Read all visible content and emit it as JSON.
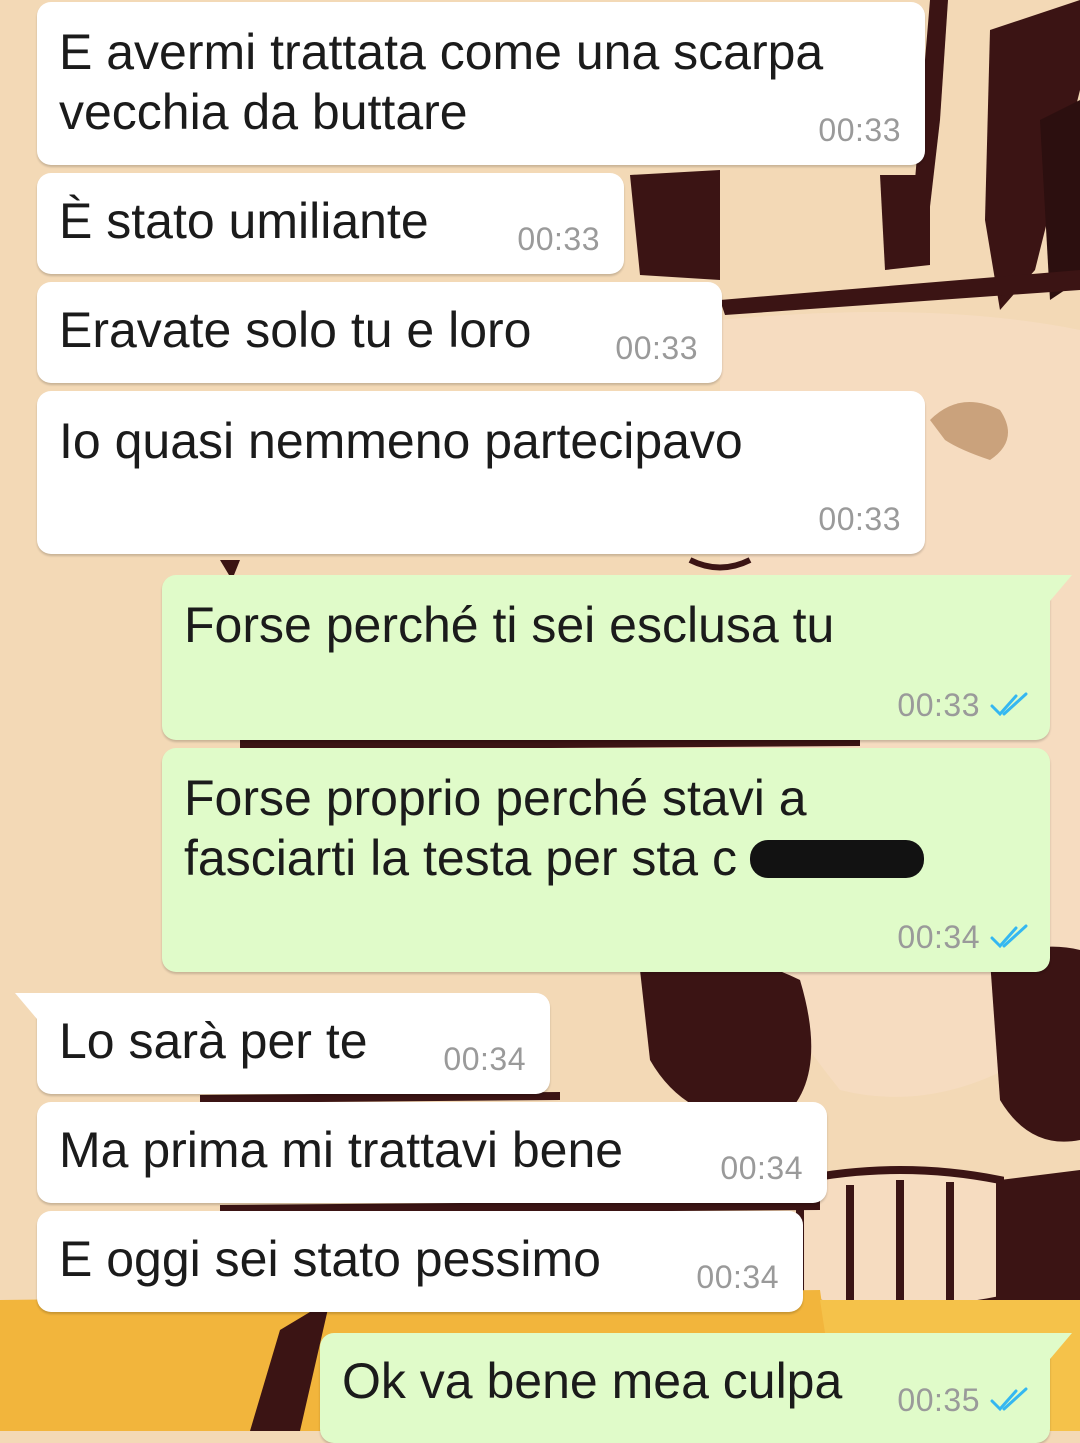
{
  "messages": [
    {
      "id": "m1",
      "direction": "incoming",
      "text": "E avermi trattata come una scarpa\nvecchia da buttare",
      "time": "00:33"
    },
    {
      "id": "m2",
      "direction": "incoming",
      "text": "È stato umiliante",
      "time": "00:33"
    },
    {
      "id": "m3",
      "direction": "incoming",
      "text": "Eravate solo tu e loro",
      "time": "00:33"
    },
    {
      "id": "m4",
      "direction": "incoming",
      "text": "Io quasi nemmeno partecipavo",
      "time": "00:33"
    },
    {
      "id": "m5",
      "direction": "outgoing",
      "text": "Forse perché ti sei esclusa tu",
      "time": "00:33",
      "status": "read"
    },
    {
      "id": "m6",
      "direction": "outgoing",
      "text": "Forse proprio perché stavi a\nfasciarti la testa per sta c",
      "time": "00:34",
      "status": "read",
      "redacted": true
    },
    {
      "id": "m7",
      "direction": "incoming",
      "text": "Lo sarà per te",
      "time": "00:34"
    },
    {
      "id": "m8",
      "direction": "incoming",
      "text": "Ma prima mi trattavi bene",
      "time": "00:34"
    },
    {
      "id": "m9",
      "direction": "incoming",
      "text": "E oggi sei stato pessimo",
      "time": "00:34"
    },
    {
      "id": "m10",
      "direction": "outgoing",
      "text": "Ok va bene mea culpa",
      "time": "00:35",
      "status": "read"
    }
  ],
  "colors": {
    "incoming_bubble": "#ffffff",
    "outgoing_bubble": "#e0fbc9",
    "read_ticks": "#34b7f1",
    "timestamp": "#9a9a9a"
  },
  "icons": {
    "read_receipt": "double-check-icon"
  }
}
